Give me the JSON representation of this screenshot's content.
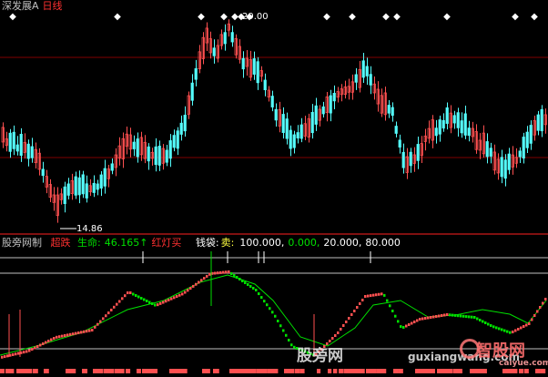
{
  "upper_panel": {
    "stock_name": "深发展A",
    "period": "日线",
    "high_label": "29.00",
    "low_label": "14.86"
  },
  "lower_panel": {
    "indicator_name": "股旁网制",
    "line_a_label": "超跌",
    "line_b_label": "生命:",
    "line_b_value": "46.165",
    "arrow": "↑",
    "signal_label": "红灯买",
    "money_label": "钱袋:",
    "sell_label": "卖:",
    "sell_value": "100.000,",
    "v2": "0.000,",
    "v3": "20.000,",
    "v4": "80.000"
  },
  "watermarks": {
    "site_cn": "股旁网",
    "site_url": "guxiangwang.com",
    "logo_cn": "智股网",
    "logo_url": "caiyue.com"
  },
  "colors": {
    "up_candle": "#ff5050",
    "down_candle": "#54fcfc",
    "line_green": "#00e000",
    "separator": "#ff2020",
    "white": "#ffffff",
    "grid": "#800000"
  }
}
